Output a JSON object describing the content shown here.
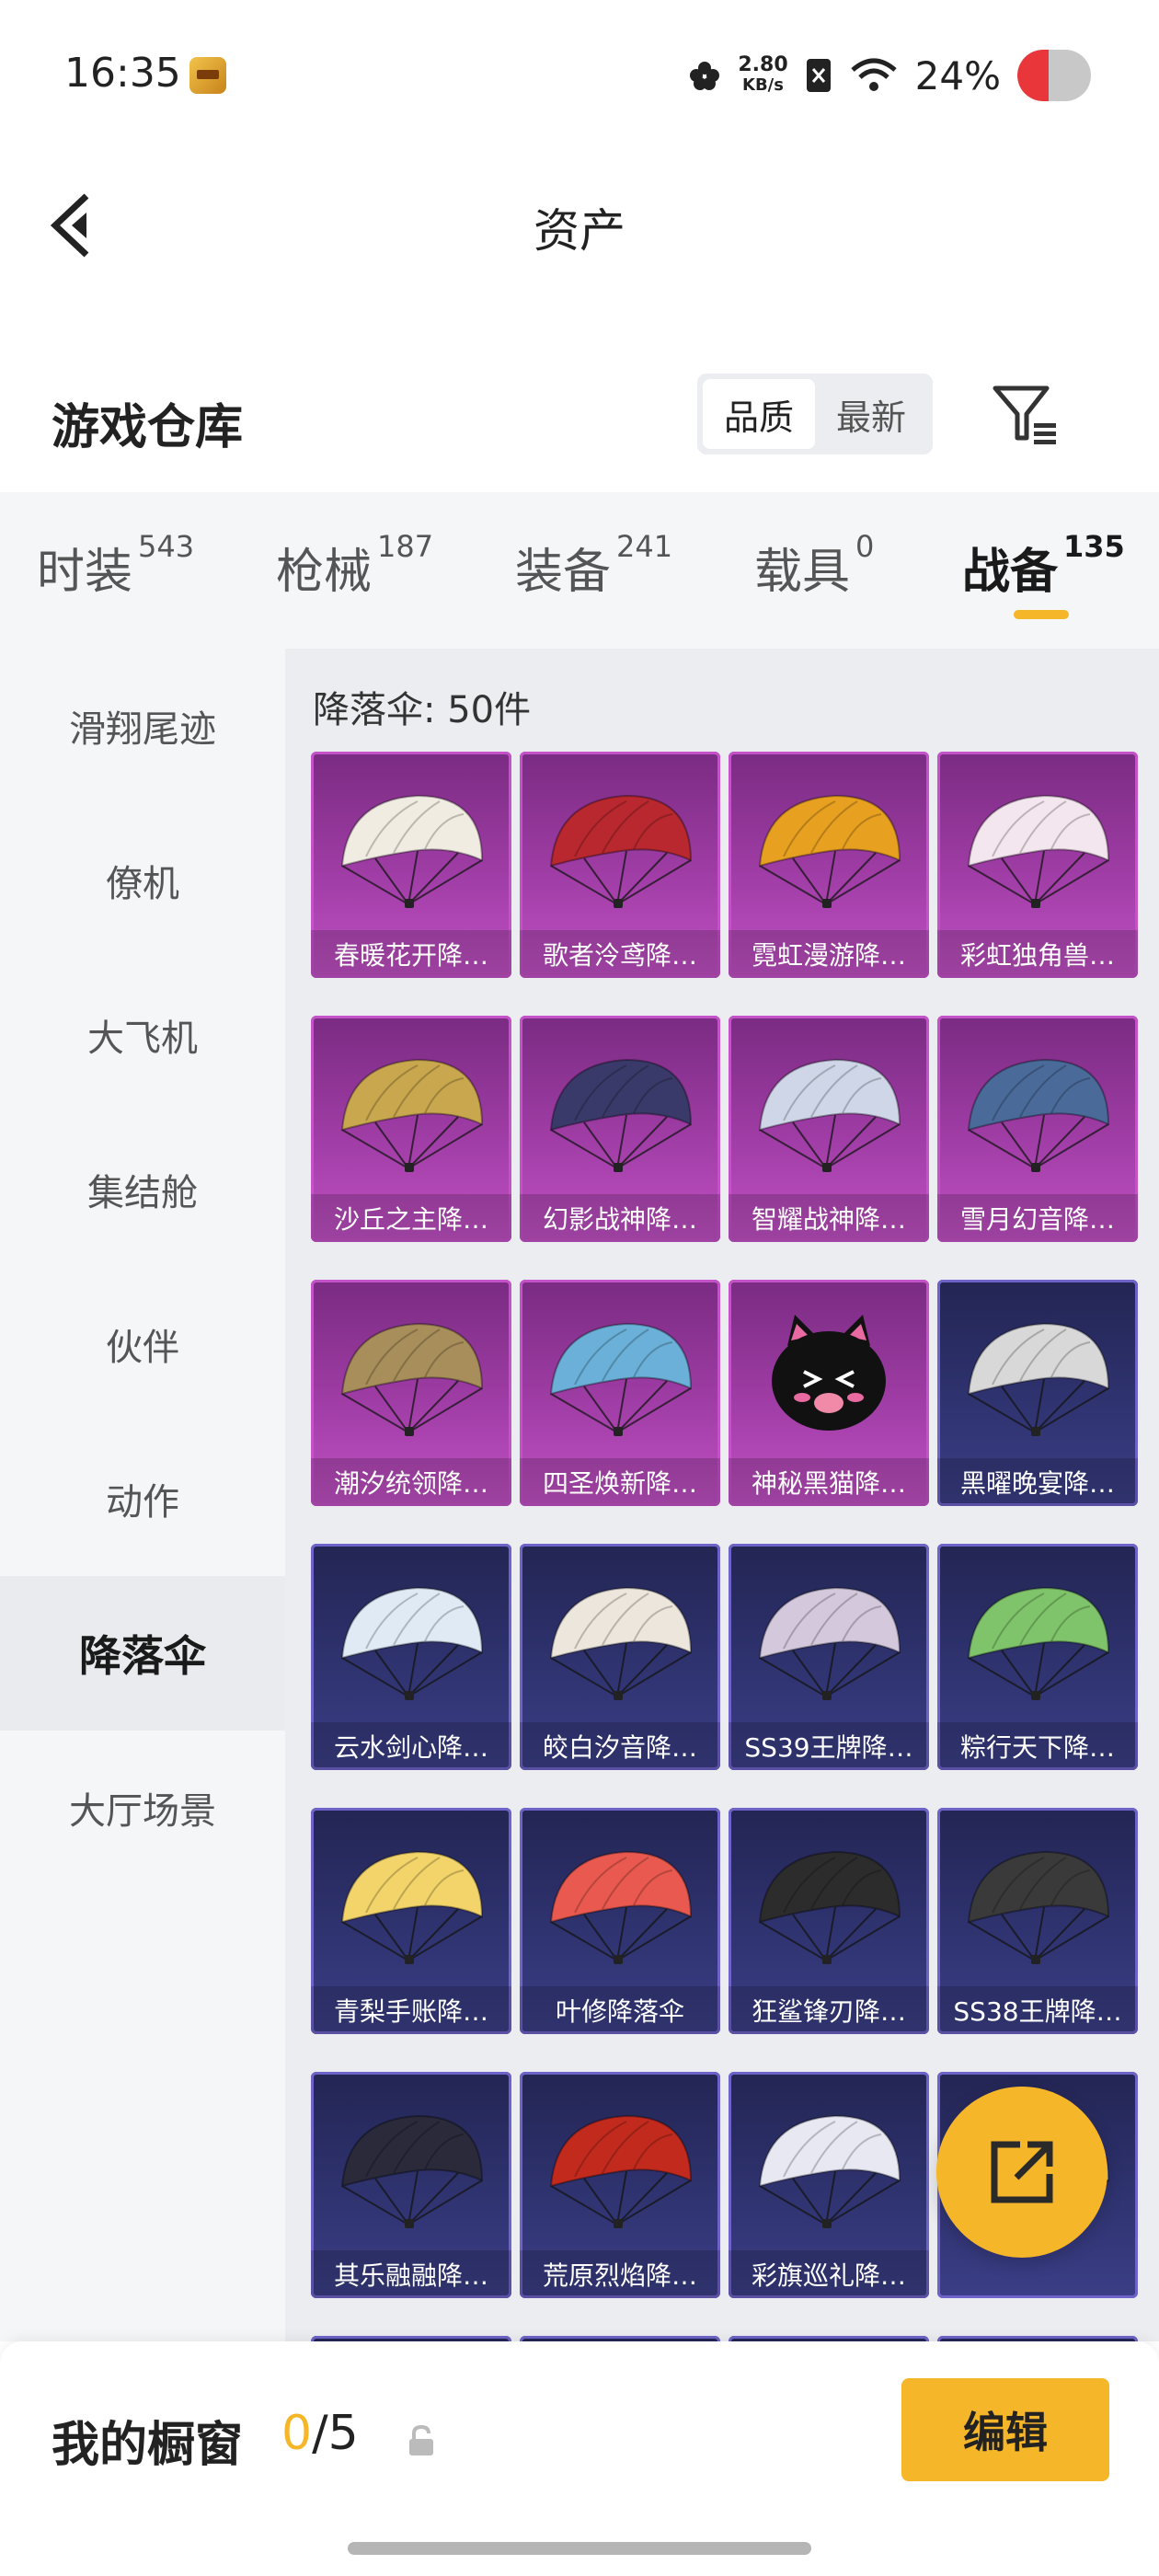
{
  "status_bar": {
    "time": "16:35",
    "speed_value": "2.80",
    "speed_unit": "KB/s",
    "battery_pct": "24%"
  },
  "header": {
    "title": "资产"
  },
  "warehouse": {
    "title": "游戏仓库",
    "sort_options": [
      "品质",
      "最新"
    ],
    "sort_active": "品质"
  },
  "tabs": [
    {
      "label": "时装",
      "count": "543"
    },
    {
      "label": "枪械",
      "count": "187"
    },
    {
      "label": "装备",
      "count": "241"
    },
    {
      "label": "载具",
      "count": "0"
    },
    {
      "label": "战备",
      "count": "135",
      "active": true
    }
  ],
  "sidebar": {
    "items": [
      "滑翔尾迹",
      "僚机",
      "大飞机",
      "集结舱",
      "伙伴",
      "动作",
      "降落伞",
      "大厅场景"
    ],
    "active": "降落伞"
  },
  "content": {
    "title": "降落伞: 50件",
    "items": [
      {
        "label": "春暖花开降…",
        "rarity": "purple",
        "icon": "parachute-icon",
        "color": "#f1ece2"
      },
      {
        "label": "歌者泠鸢降…",
        "rarity": "purple",
        "icon": "parachute-icon",
        "color": "#b8282e"
      },
      {
        "label": "霓虹漫游降…",
        "rarity": "purple",
        "icon": "parachute-icon",
        "color": "#e8a020"
      },
      {
        "label": "彩虹独角兽…",
        "rarity": "purple",
        "icon": "parachute-icon",
        "color": "#f4e6ee"
      },
      {
        "label": "沙丘之主降…",
        "rarity": "purple",
        "icon": "parachute-icon",
        "color": "#c9a74e"
      },
      {
        "label": "幻影战神降…",
        "rarity": "purple",
        "icon": "parachute-icon",
        "color": "#3a3a6a"
      },
      {
        "label": "智耀战神降…",
        "rarity": "purple",
        "icon": "parachute-icon",
        "color": "#cfd6e8"
      },
      {
        "label": "雪月幻音降…",
        "rarity": "purple",
        "icon": "parachute-icon",
        "color": "#4a6a9a"
      },
      {
        "label": "潮汐统领降…",
        "rarity": "purple",
        "icon": "parachute-icon",
        "color": "#a88e5a"
      },
      {
        "label": "四圣焕新降…",
        "rarity": "purple",
        "icon": "parachute-icon",
        "color": "#6ab0d8"
      },
      {
        "label": "神秘黑猫降…",
        "rarity": "purple",
        "icon": "black-cat-icon",
        "color": "#111111"
      },
      {
        "label": "黑曜晚宴降…",
        "rarity": "blue",
        "icon": "parachute-icon",
        "color": "#d8d8d8"
      },
      {
        "label": "云水剑心降…",
        "rarity": "blue",
        "icon": "parachute-icon",
        "color": "#dfeaf4"
      },
      {
        "label": "皎白汐音降…",
        "rarity": "blue",
        "icon": "parachute-icon",
        "color": "#ece6dc"
      },
      {
        "label": "SS39王牌降…",
        "rarity": "blue",
        "icon": "parachute-icon",
        "color": "#d4c8dc"
      },
      {
        "label": "粽行天下降…",
        "rarity": "blue",
        "icon": "parachute-icon",
        "color": "#7fc46a"
      },
      {
        "label": "青梨手账降…",
        "rarity": "blue",
        "icon": "parachute-icon",
        "color": "#f2d46a"
      },
      {
        "label": "叶修降落伞",
        "rarity": "blue",
        "icon": "parachute-icon",
        "color": "#e9594f"
      },
      {
        "label": "狂鲨锋刃降…",
        "rarity": "blue",
        "icon": "parachute-icon",
        "color": "#2c2c2c"
      },
      {
        "label": "SS38王牌降…",
        "rarity": "blue",
        "icon": "parachute-icon",
        "color": "#3a3a3a"
      },
      {
        "label": "其乐融融降…",
        "rarity": "blue",
        "icon": "parachute-icon",
        "color": "#2a2a3a"
      },
      {
        "label": "荒原烈焰降…",
        "rarity": "blue",
        "icon": "parachute-icon",
        "color": "#c22a1e"
      },
      {
        "label": "彩旗巡礼降…",
        "rarity": "blue",
        "icon": "parachute-icon",
        "color": "#e8e8f2"
      },
      {
        "label": "",
        "rarity": "blue",
        "icon": "parachute-icon",
        "color": "#d8cdb0"
      },
      {
        "label": "",
        "rarity": "blue",
        "icon": "parachute-icon",
        "color": "#e4e8f0"
      },
      {
        "label": "",
        "rarity": "blue",
        "icon": "parachute-icon",
        "color": "#e07a3a"
      },
      {
        "label": "",
        "rarity": "blue",
        "icon": "parachute-icon",
        "color": "#a8d8d2"
      },
      {
        "label": "",
        "rarity": "blue",
        "icon": "parachute-icon",
        "color": "#b0302a"
      }
    ]
  },
  "showcase": {
    "label": "我的橱窗",
    "current": "0",
    "max": "/5"
  },
  "edit_button": "编辑",
  "colors": {
    "accent": "#f5b62a",
    "purple_card": "#a03da6",
    "blue_card": "#2f3370"
  }
}
